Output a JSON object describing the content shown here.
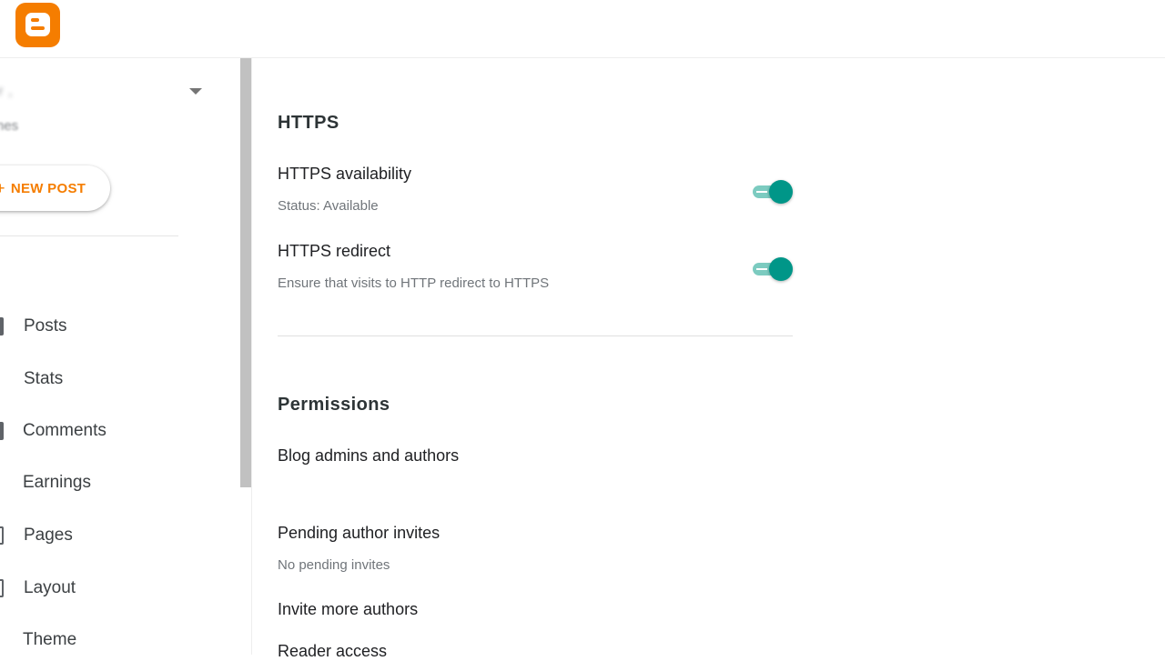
{
  "app": {
    "logo_icon": "blogger-logo-icon",
    "brand_color": "#f57d00"
  },
  "sidebar": {
    "blog_name": "r                  ,",
    "blog_subtitle": "nes",
    "new_post_label": "NEW POST",
    "new_post_icon": "plus-icon",
    "view_blog_label": "                ",
    "items": [
      {
        "label": "Posts",
        "icon": "posts-icon"
      },
      {
        "label": "Stats",
        "icon": "stats-icon"
      },
      {
        "label": "Comments",
        "icon": "comments-icon"
      },
      {
        "label": "Earnings",
        "icon": "earnings-icon"
      },
      {
        "label": "Pages",
        "icon": "pages-icon"
      },
      {
        "label": "Layout",
        "icon": "layout-icon"
      },
      {
        "label": "Theme",
        "icon": "theme-icon"
      }
    ]
  },
  "main": {
    "https": {
      "title": "HTTPS",
      "availability_title": "HTTPS availability",
      "availability_status": "Status: Available",
      "availability_enabled": true,
      "redirect_title": "HTTPS redirect",
      "redirect_desc": "Ensure that visits to HTTP redirect to HTTPS",
      "redirect_enabled": true
    },
    "permissions": {
      "title": "Permissions",
      "admins_title": "Blog admins and authors",
      "admins_detail": "                         ",
      "pending_title": "Pending author invites",
      "pending_desc": "No pending invites",
      "invite_title": "Invite more authors",
      "reader_title": "Reader access"
    },
    "toggle_color": "#009688"
  }
}
